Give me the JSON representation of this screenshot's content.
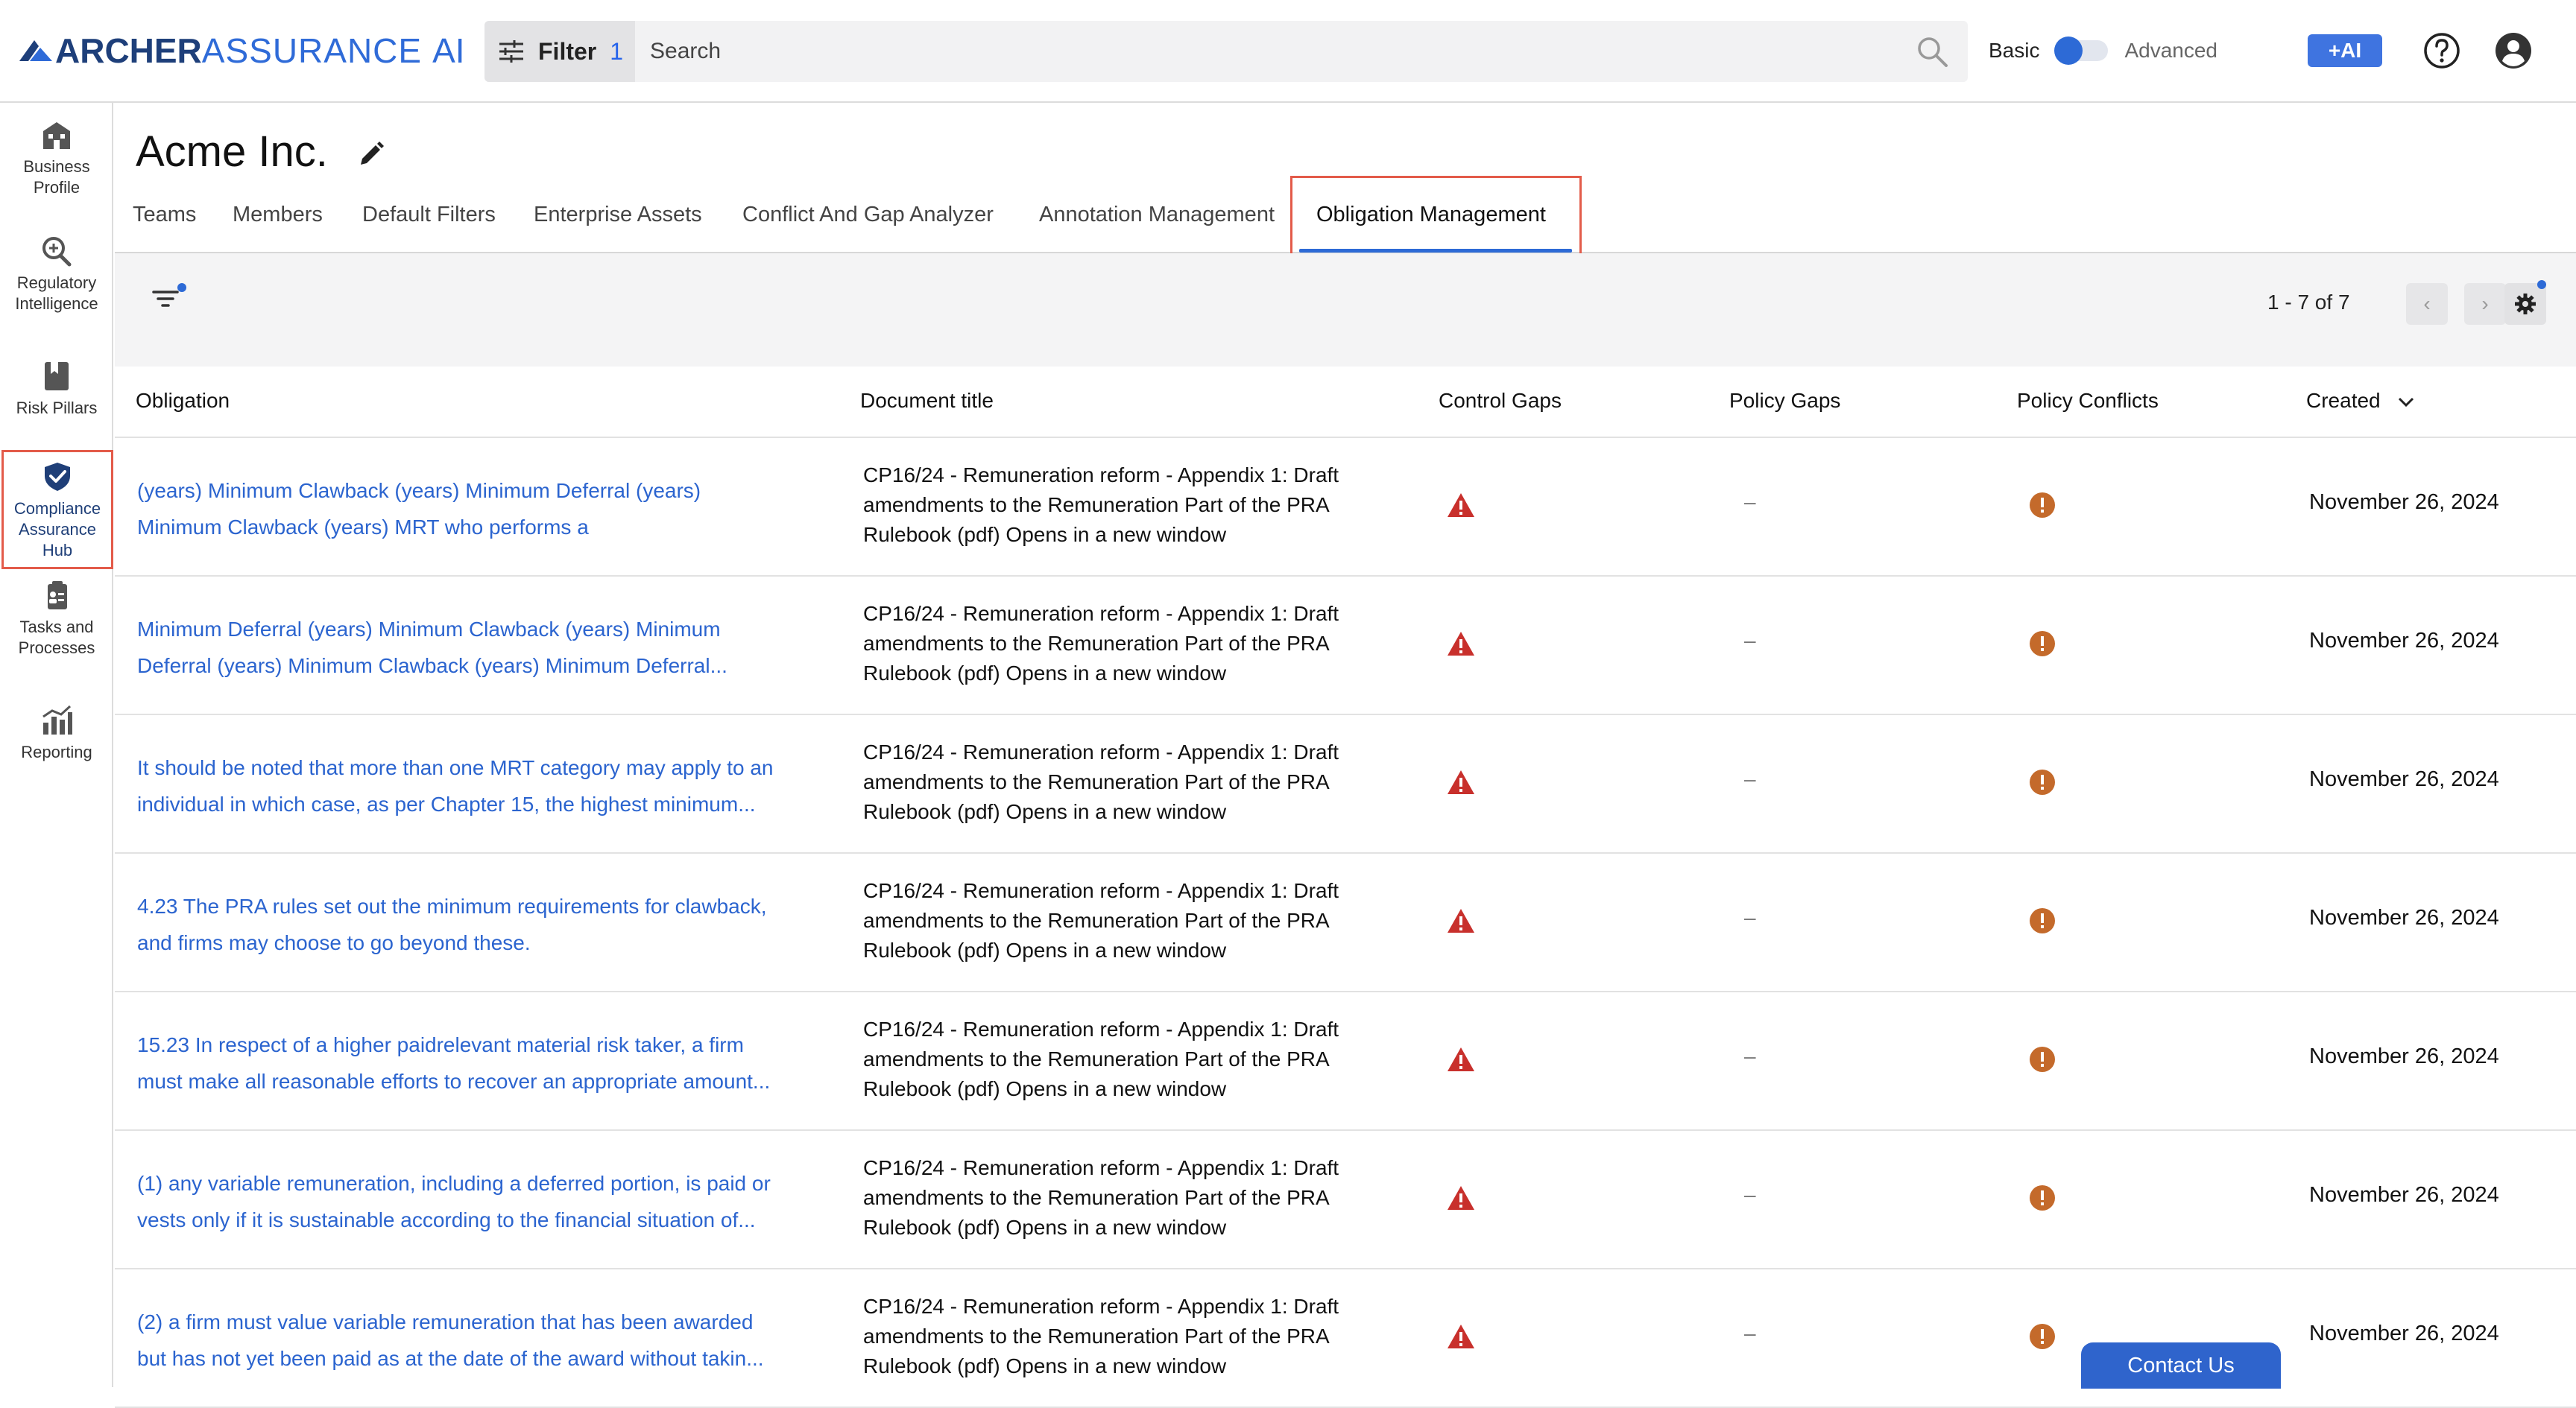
{
  "app": {
    "logo_archer": "ARCHER",
    "logo_assurance": "ASSURANCE",
    "logo_ai": "AI"
  },
  "topbar": {
    "filter_label": "Filter",
    "filter_count": "1",
    "search_placeholder": "Search",
    "mode_basic": "Basic",
    "mode_advanced": "Advanced",
    "ai_button": "+AI"
  },
  "sidebar": {
    "items": [
      {
        "label": "Business Profile",
        "icon": "building-icon"
      },
      {
        "label": "Regulatory Intelligence",
        "icon": "magnify-plus-icon"
      },
      {
        "label": "Risk Pillars",
        "icon": "bookmark-book-icon"
      },
      {
        "label": "Compliance Assurance Hub",
        "icon": "shield-check-icon"
      },
      {
        "label": "Tasks and Processes",
        "icon": "clipboard-person-icon"
      },
      {
        "label": "Reporting",
        "icon": "chart-icon"
      }
    ]
  },
  "page": {
    "title": "Acme Inc."
  },
  "tabs": [
    "Teams",
    "Members",
    "Default Filters",
    "Enterprise Assets",
    "Conflict And Gap Analyzer",
    "Annotation Management",
    "Obligation Management"
  ],
  "pagination": {
    "info": "1 - 7 of 7"
  },
  "table": {
    "headers": {
      "obligation": "Obligation",
      "document": "Document title",
      "control_gaps": "Control Gaps",
      "policy_gaps": "Policy Gaps",
      "policy_conflicts": "Policy Conflicts",
      "created": "Created"
    },
    "rows": [
      {
        "obligation_l1": "(years) Minimum Clawback (years) Minimum Deferral (years)",
        "obligation_l2": "Minimum Clawback (years) MRT who performs a",
        "doc_l1": "CP16/24 - Remuneration reform - Appendix 1: Draft",
        "doc_l2": "amendments to the Remuneration Part of the PRA",
        "doc_l3": "Rulebook (pdf) Opens in a new window",
        "policy_gaps": "–",
        "created": "November 26, 2024"
      },
      {
        "obligation_l1": "Minimum Deferral (years) Minimum Clawback (years) Minimum",
        "obligation_l2": "Deferral (years) Minimum Clawback (years) Minimum Deferral...",
        "doc_l1": "CP16/24 - Remuneration reform - Appendix 1: Draft",
        "doc_l2": "amendments to the Remuneration Part of the PRA",
        "doc_l3": "Rulebook (pdf) Opens in a new window",
        "policy_gaps": "–",
        "created": "November 26, 2024"
      },
      {
        "obligation_l1": "It should be noted that more than one MRT category may apply to an",
        "obligation_l2": "individual in which case, as per Chapter 15, the highest minimum...",
        "doc_l1": "CP16/24 - Remuneration reform - Appendix 1: Draft",
        "doc_l2": "amendments to the Remuneration Part of the PRA",
        "doc_l3": "Rulebook (pdf) Opens in a new window",
        "policy_gaps": "–",
        "created": "November 26, 2024"
      },
      {
        "obligation_l1": "4.23 The PRA rules set out the minimum requirements for clawback,",
        "obligation_l2": "and firms may choose to go beyond these.",
        "doc_l1": "CP16/24 - Remuneration reform - Appendix 1: Draft",
        "doc_l2": "amendments to the Remuneration Part of the PRA",
        "doc_l3": "Rulebook (pdf) Opens in a new window",
        "policy_gaps": "–",
        "created": "November 26, 2024"
      },
      {
        "obligation_l1": "15.23 In respect of a higher paidrelevant material risk taker, a firm",
        "obligation_l2": "must make all reasonable efforts to recover an appropriate amount...",
        "doc_l1": "CP16/24 - Remuneration reform - Appendix 1: Draft",
        "doc_l2": "amendments to the Remuneration Part of the PRA",
        "doc_l3": "Rulebook (pdf) Opens in a new window",
        "policy_gaps": "–",
        "created": "November 26, 2024"
      },
      {
        "obligation_l1": "(1) any variable remuneration, including a deferred portion, is paid or",
        "obligation_l2": "vests only if it is sustainable according to the financial situation of...",
        "doc_l1": "CP16/24 - Remuneration reform - Appendix 1: Draft",
        "doc_l2": "amendments to the Remuneration Part of the PRA",
        "doc_l3": "Rulebook (pdf) Opens in a new window",
        "policy_gaps": "–",
        "created": "November 26, 2024"
      },
      {
        "obligation_l1": "(2) a firm must value variable remuneration that has been awarded",
        "obligation_l2": "but has not yet been paid as at the date of the award without takin...",
        "doc_l1": "CP16/24 - Remuneration reform - Appendix 1: Draft",
        "doc_l2": "amendments to the Remuneration Part of the PRA",
        "doc_l3": "Rulebook (pdf) Opens in a new window",
        "policy_gaps": "–",
        "created": "November 26, 2024"
      }
    ]
  },
  "footer": {
    "contact": "Contact Us"
  },
  "colors": {
    "brand_dark": "#1e3f7a",
    "brand": "#2f6bd8",
    "link": "#2b64cf",
    "danger": "#c8302c",
    "warning": "#c46a2b",
    "highlight": "#e35b4a"
  }
}
